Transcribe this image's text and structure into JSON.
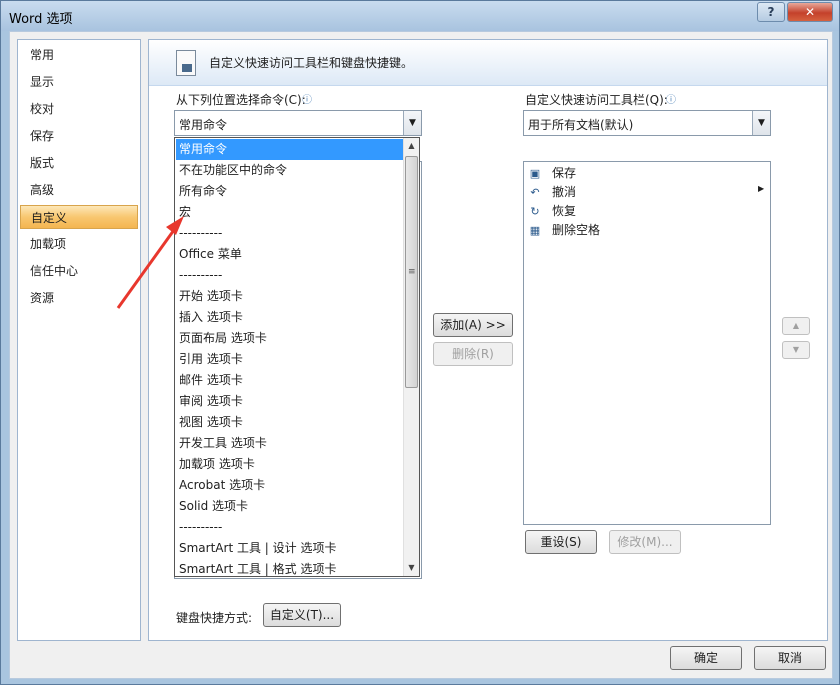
{
  "window": {
    "title": "Word 选项",
    "help_label": "?",
    "close_label": "✕"
  },
  "nav": {
    "items": [
      {
        "label": "常用",
        "active": false
      },
      {
        "label": "显示",
        "active": false
      },
      {
        "label": "校对",
        "active": false
      },
      {
        "label": "保存",
        "active": false
      },
      {
        "label": "版式",
        "active": false
      },
      {
        "label": "高级",
        "active": false
      },
      {
        "label": "自定义",
        "active": true
      },
      {
        "label": "加载项",
        "active": false
      },
      {
        "label": "信任中心",
        "active": false
      },
      {
        "label": "资源",
        "active": false
      }
    ]
  },
  "main": {
    "header_text": "自定义快速访问工具栏和键盘快捷键。",
    "choose_from_label": "从下列位置选择命令(C):",
    "choose_from_value": "常用命令",
    "customize_label": "自定义快速访问工具栏(Q):",
    "customize_value": "用于所有文档(默认)",
    "dropdown_items": [
      "常用命令",
      "不在功能区中的命令",
      "所有命令",
      "宏",
      "----------",
      "Office 菜单",
      "----------",
      "开始 选项卡",
      "插入 选项卡",
      "页面布局 选项卡",
      "引用 选项卡",
      "邮件 选项卡",
      "审阅 选项卡",
      "视图 选项卡",
      "开发工具 选项卡",
      "加载项 选项卡",
      "Acrobat 选项卡",
      "Solid 选项卡",
      "----------",
      "SmartArt 工具 | 设计 选项卡",
      "SmartArt 工具 | 格式 选项卡"
    ],
    "selected_index": 0,
    "qa_items": [
      {
        "label": "保存",
        "icon": "save-icon"
      },
      {
        "label": "撤消",
        "icon": "undo-icon"
      },
      {
        "label": "恢复",
        "icon": "redo-icon"
      },
      {
        "label": "删除空格",
        "icon": "delete-space-icon"
      }
    ],
    "add_button": "添加(A) >>",
    "remove_button": "删除(R)",
    "reset_button": "重设(S)",
    "modify_button": "修改(M)...",
    "keyboard_label": "键盘快捷方式:",
    "keyboard_button": "自定义(T)...",
    "move_up": "▲",
    "move_down": "▼"
  },
  "footer": {
    "ok": "确定",
    "cancel": "取消"
  }
}
